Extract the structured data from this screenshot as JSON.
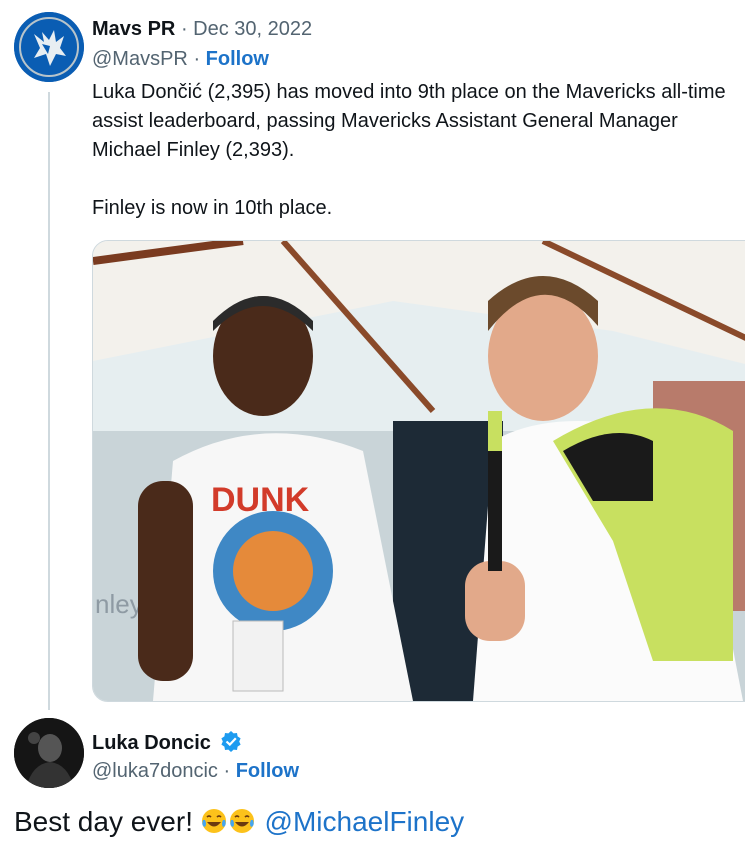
{
  "colors": {
    "link": "#1d73c9",
    "muted": "#536471",
    "text": "#0f1419",
    "verified": "#1d9bf0"
  },
  "tweet": {
    "author_name": "Mavs PR",
    "date": "Dec 30, 2022",
    "handle": "@MavsPR",
    "follow_label": "Follow",
    "text": "Luka Dončić (2,395) has moved into 9th place on the Mavericks all-time assist leaderboard, passing Mavericks Assistant General Manager Michael Finley (2,393).\n\nFinley is now in 10th place.",
    "image_shirt_text": "DUNK",
    "image_edge_text": "nley"
  },
  "quoted_by": {
    "author_name": "Luka Doncic",
    "verified_icon": "verified-badge-icon",
    "handle": "@luka7doncic",
    "follow_label": "Follow",
    "text": "Best day ever!",
    "emoji_icon": "tears-of-joy-emoji",
    "mention": "@MichaelFinley"
  }
}
